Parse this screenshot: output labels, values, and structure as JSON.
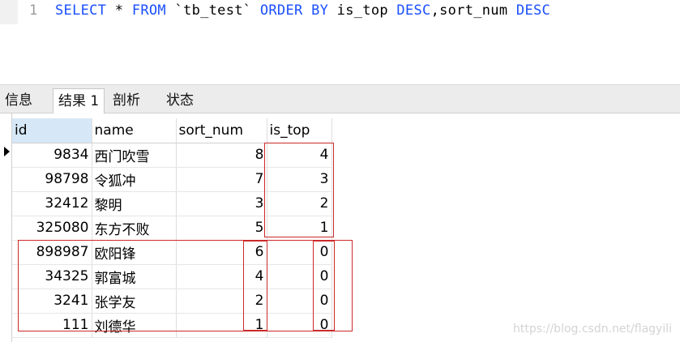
{
  "editor": {
    "line_number": "1",
    "tokens": [
      {
        "text": "SELECT",
        "kind": "kw"
      },
      {
        "text": " * ",
        "kind": "tx"
      },
      {
        "text": "FROM",
        "kind": "kw"
      },
      {
        "text": " `tb_test` ",
        "kind": "tx"
      },
      {
        "text": "ORDER BY",
        "kind": "kw"
      },
      {
        "text": " is_top ",
        "kind": "tx"
      },
      {
        "text": "DESC",
        "kind": "kw"
      },
      {
        "text": ",sort_num ",
        "kind": "tx"
      },
      {
        "text": "DESC",
        "kind": "kw"
      }
    ]
  },
  "tabs": [
    {
      "label": "信息",
      "active": false
    },
    {
      "label": "结果 1",
      "active": true
    },
    {
      "label": "剖析",
      "active": false
    },
    {
      "label": "状态",
      "active": false
    }
  ],
  "results": {
    "columns": [
      "id",
      "name",
      "sort_num",
      "is_top"
    ],
    "selected_column": "id",
    "rows": [
      [
        "9834",
        "西门吹雪",
        "8",
        "4"
      ],
      [
        "98798",
        "令狐冲",
        "7",
        "3"
      ],
      [
        "32412",
        "黎明",
        "3",
        "2"
      ],
      [
        "325080",
        "东方不败",
        "5",
        "1"
      ],
      [
        "898987",
        "欧阳锋",
        "6",
        "0"
      ],
      [
        "34325",
        "郭富城",
        "4",
        "0"
      ],
      [
        "3241",
        "张学友",
        "2",
        "0"
      ],
      [
        "111",
        "刘德华",
        "1",
        "0"
      ]
    ]
  },
  "watermark": "https://blog.csdn.net/flagyili",
  "colors": {
    "keyword": "#1a4fff",
    "highlight_box": "#cc2a2a",
    "selected_header": "#d6e8f7"
  }
}
